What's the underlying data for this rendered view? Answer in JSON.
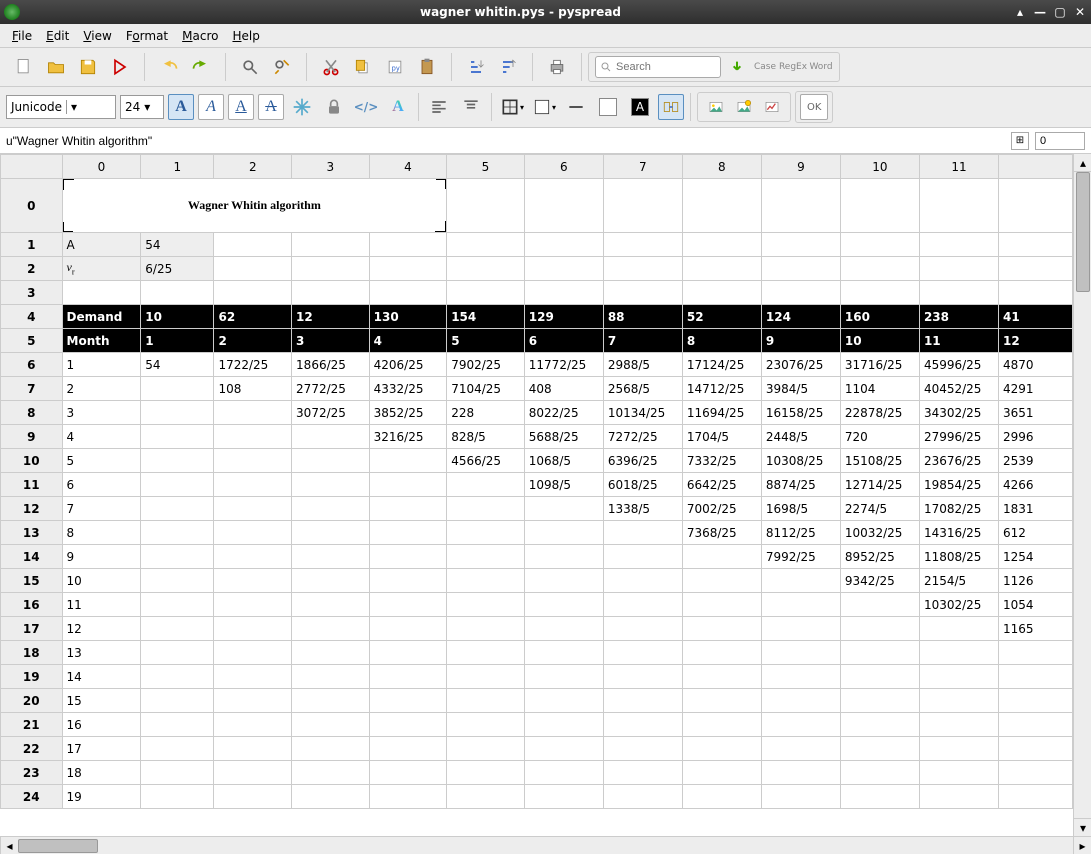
{
  "window": {
    "title": "wagner whitin.pys - pyspread"
  },
  "menu": {
    "file": "File",
    "edit": "Edit",
    "view": "View",
    "format": "Format",
    "macro": "Macro",
    "help": "Help"
  },
  "toolbar": {
    "search_placeholder": "Search",
    "font_name": "Junicode",
    "font_size": "24",
    "ok_label": "OK",
    "icons": {
      "case": "Case",
      "regex": "RegEx",
      "word": "Word"
    }
  },
  "formula": {
    "text": "u\"Wagner Whitin algorithm\"",
    "tab": "0"
  },
  "grid": {
    "title": "Wagner Whitin algorithm",
    "col_headers": [
      "0",
      "1",
      "2",
      "3",
      "4",
      "5",
      "6",
      "7",
      "8",
      "9",
      "10",
      "11"
    ],
    "rows": [
      {
        "h": "1",
        "c": [
          "A",
          "54",
          "",
          "",
          "",
          "",
          "",
          "",
          "",
          "",
          "",
          ""
        ],
        "shadeEnd": 2
      },
      {
        "h": "2",
        "c": [
          "v_r",
          "6/25",
          "",
          "",
          "",
          "",
          "",
          "",
          "",
          "",
          "",
          ""
        ],
        "shadeEnd": 2
      },
      {
        "h": "3",
        "c": [
          "",
          "",
          "",
          "",
          "",
          "",
          "",
          "",
          "",
          "",
          "",
          ""
        ]
      },
      {
        "h": "4",
        "hdr": true,
        "c": [
          "Demand",
          "10",
          "62",
          "12",
          "130",
          "154",
          "129",
          "88",
          "52",
          "124",
          "160",
          "238"
        ],
        "extra": "41"
      },
      {
        "h": "5",
        "hdr": true,
        "c": [
          "Month",
          "1",
          "2",
          "3",
          "4",
          "5",
          "6",
          "7",
          "8",
          "9",
          "10",
          "11"
        ],
        "extra": "12"
      },
      {
        "h": "6",
        "c": [
          "1",
          "54",
          "1722/25",
          "1866/25",
          "4206/25",
          "7902/25",
          "11772/25",
          "2988/5",
          "17124/25",
          "23076/25",
          "31716/25",
          "45996/25"
        ],
        "extra": "4870"
      },
      {
        "h": "7",
        "c": [
          "2",
          "",
          "108",
          "2772/25",
          "4332/25",
          "7104/25",
          "408",
          "2568/5",
          "14712/25",
          "3984/5",
          "1104",
          "40452/25"
        ],
        "extra": "4291"
      },
      {
        "h": "8",
        "c": [
          "3",
          "",
          "",
          "3072/25",
          "3852/25",
          "228",
          "8022/25",
          "10134/25",
          "11694/25",
          "16158/25",
          "22878/25",
          "34302/25"
        ],
        "extra": "3651"
      },
      {
        "h": "9",
        "c": [
          "4",
          "",
          "",
          "",
          "3216/25",
          "828/5",
          "5688/25",
          "7272/25",
          "1704/5",
          "2448/5",
          "720",
          "27996/25"
        ],
        "extra": "2996"
      },
      {
        "h": "10",
        "c": [
          "5",
          "",
          "",
          "",
          "",
          "4566/25",
          "1068/5",
          "6396/25",
          "7332/25",
          "10308/25",
          "15108/25",
          "23676/25"
        ],
        "extra": "2539"
      },
      {
        "h": "11",
        "c": [
          "6",
          "",
          "",
          "",
          "",
          "",
          "1098/5",
          "6018/25",
          "6642/25",
          "8874/25",
          "12714/25",
          "19854/25"
        ],
        "extra": "4266"
      },
      {
        "h": "12",
        "c": [
          "7",
          "",
          "",
          "",
          "",
          "",
          "",
          "1338/5",
          "7002/25",
          "1698/5",
          "2274/5",
          "17082/25"
        ],
        "extra": "1831"
      },
      {
        "h": "13",
        "c": [
          "8",
          "",
          "",
          "",
          "",
          "",
          "",
          "",
          "7368/25",
          "8112/25",
          "10032/25",
          "14316/25"
        ],
        "extra": "612"
      },
      {
        "h": "14",
        "c": [
          "9",
          "",
          "",
          "",
          "",
          "",
          "",
          "",
          "",
          "7992/25",
          "8952/25",
          "11808/25"
        ],
        "extra": "1254"
      },
      {
        "h": "15",
        "c": [
          "10",
          "",
          "",
          "",
          "",
          "",
          "",
          "",
          "",
          "",
          "9342/25",
          "2154/5"
        ],
        "extra": "1126"
      },
      {
        "h": "16",
        "c": [
          "11",
          "",
          "",
          "",
          "",
          "",
          "",
          "",
          "",
          "",
          "",
          "10302/25"
        ],
        "extra": "1054"
      },
      {
        "h": "17",
        "c": [
          "12",
          "",
          "",
          "",
          "",
          "",
          "",
          "",
          "",
          "",
          "",
          ""
        ],
        "extra": "1165"
      },
      {
        "h": "18",
        "c": [
          "13",
          "",
          "",
          "",
          "",
          "",
          "",
          "",
          "",
          "",
          "",
          ""
        ]
      },
      {
        "h": "19",
        "c": [
          "14",
          "",
          "",
          "",
          "",
          "",
          "",
          "",
          "",
          "",
          "",
          ""
        ]
      },
      {
        "h": "20",
        "c": [
          "15",
          "",
          "",
          "",
          "",
          "",
          "",
          "",
          "",
          "",
          "",
          ""
        ]
      },
      {
        "h": "21",
        "c": [
          "16",
          "",
          "",
          "",
          "",
          "",
          "",
          "",
          "",
          "",
          "",
          ""
        ]
      },
      {
        "h": "22",
        "c": [
          "17",
          "",
          "",
          "",
          "",
          "",
          "",
          "",
          "",
          "",
          "",
          ""
        ]
      },
      {
        "h": "23",
        "c": [
          "18",
          "",
          "",
          "",
          "",
          "",
          "",
          "",
          "",
          "",
          "",
          ""
        ]
      },
      {
        "h": "24",
        "c": [
          "19",
          "",
          "",
          "",
          "",
          "",
          "",
          "",
          "",
          "",
          "",
          ""
        ]
      }
    ]
  }
}
